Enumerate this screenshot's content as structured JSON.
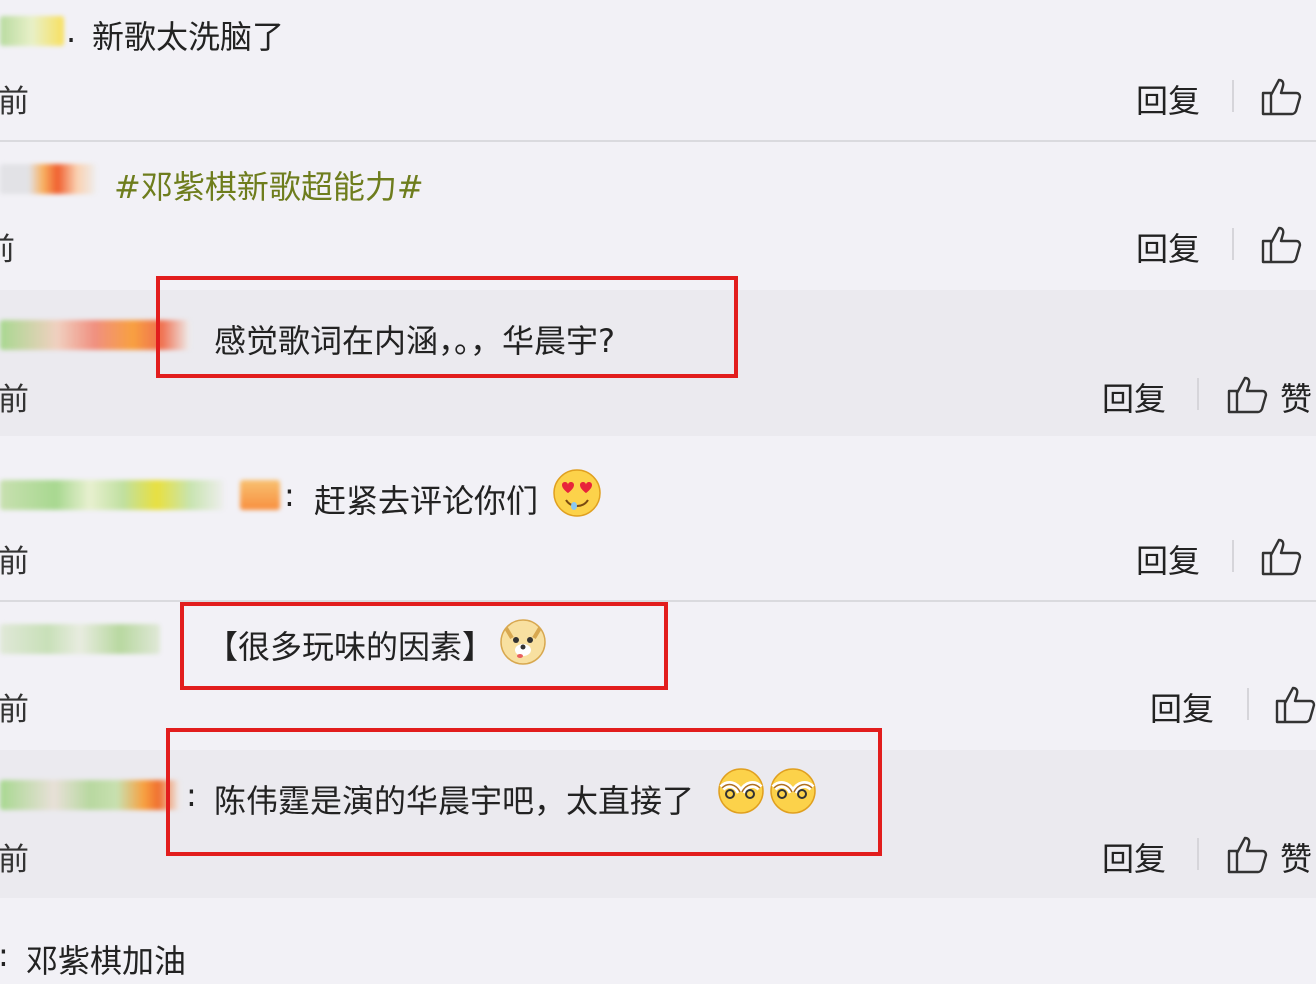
{
  "comments": [
    {
      "text": "新歌太洗脑了",
      "time": "前",
      "reply": "回复"
    },
    {
      "text": "#邓紫棋新歌超能力#",
      "time": "前",
      "reply": "回复"
    },
    {
      "text": "感觉歌词在内涵，。，华晨宇?",
      "time": "前",
      "reply": "回复",
      "like": "赞"
    },
    {
      "text": "赶紧去评论你们",
      "time": "前",
      "reply": "回复",
      "emoji": "heart-eyes-emoji"
    },
    {
      "text": "【很多玩味的因素】",
      "time": "前",
      "reply": "回复",
      "emoji": "doge-emoji"
    },
    {
      "text": "陈伟霆是演的华晨宇吧，太直接了",
      "time": "前",
      "reply": "回复",
      "like": "赞",
      "emoji": "facepalm-emoji"
    },
    {
      "text": "邓紫棋加油"
    }
  ],
  "colors": {
    "highlight_box": "#e21d1d",
    "topic": "#6e7d1d",
    "background": "#f2f1f6"
  },
  "icons": {
    "like": "thumbs-up-icon"
  }
}
